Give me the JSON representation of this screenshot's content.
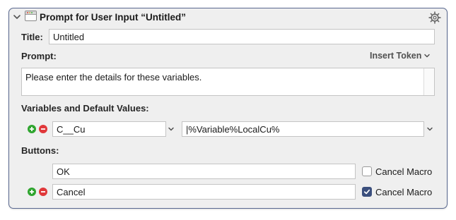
{
  "header": {
    "title": "Prompt for User Input “Untitled”"
  },
  "title_row": {
    "label": "Title:",
    "value": "Untitled"
  },
  "prompt_row": {
    "label": "Prompt:",
    "insert_token": "Insert Token",
    "value": "Please enter the details for these variables."
  },
  "variables": {
    "label": "Variables and Default Values:",
    "rows": [
      {
        "name": "C__Cu",
        "default": "|%Variable%LocalCu%"
      }
    ]
  },
  "buttons": {
    "label": "Buttons:",
    "rows": [
      {
        "value": "OK",
        "cancel_label": "Cancel Macro",
        "cancel_checked": false
      },
      {
        "value": "Cancel",
        "cancel_label": "Cancel Macro",
        "cancel_checked": true
      }
    ]
  },
  "icons": {
    "collapse": "chevron-down-icon",
    "action": "window-icon",
    "settings": "gear-icon",
    "add": "plus-circle-icon",
    "remove": "minus-circle-icon",
    "check": "checkmark-icon"
  },
  "colors": {
    "panel_border": "#5a6990",
    "panel_bg": "#efefef",
    "add_green": "#2fa52f",
    "remove_red": "#e0383a",
    "checkbox_checked": "#3b4f7d"
  }
}
